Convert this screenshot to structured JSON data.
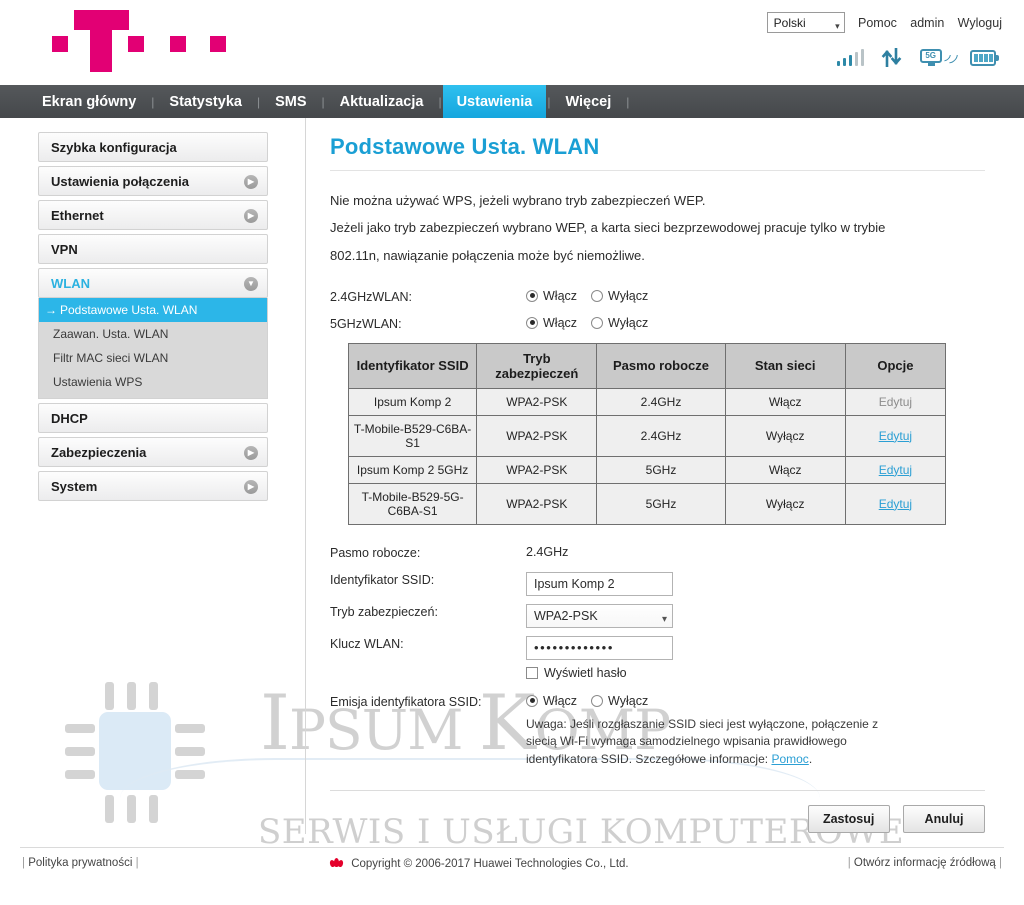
{
  "header": {
    "logo_name": "t-mobile-logo",
    "language": {
      "value": "Polski",
      "caret": "▾"
    },
    "links": [
      {
        "name": "help-link",
        "label": "Pomoc"
      },
      {
        "name": "account-link",
        "label": "admin"
      },
      {
        "name": "logout-link",
        "label": "Wyloguj"
      }
    ],
    "status_icons": [
      {
        "name": "signal-bars-icon",
        "label": "signal-bars"
      },
      {
        "name": "data-transfer-icon",
        "label": "up-down-arrows"
      },
      {
        "name": "network-5g-icon",
        "label": "5G"
      },
      {
        "name": "battery-icon",
        "label": "battery-full"
      }
    ]
  },
  "nav": {
    "separator": "|",
    "items": [
      {
        "label": "Ekran główny",
        "active": false
      },
      {
        "label": "Statystyka",
        "active": false
      },
      {
        "label": "SMS",
        "active": false
      },
      {
        "label": "Aktualizacja",
        "active": false
      },
      {
        "label": "Ustawienia",
        "active": true
      },
      {
        "label": "Więcej",
        "active": false
      }
    ]
  },
  "sidebar": {
    "items": [
      {
        "label": "Szybka konfiguracja",
        "arrow": false
      },
      {
        "label": "Ustawienia połączenia",
        "arrow": true
      },
      {
        "label": "Ethernet",
        "arrow": true
      },
      {
        "label": "VPN",
        "arrow": false
      },
      {
        "label": "WLAN",
        "arrow": true,
        "open": true
      },
      {
        "label": "DHCP",
        "arrow": false
      },
      {
        "label": "Zabezpieczenia",
        "arrow": true
      },
      {
        "label": "System",
        "arrow": true
      }
    ],
    "wlan_subitems": [
      {
        "label": "Podstawowe Usta. WLAN",
        "active": true,
        "arrow": "→"
      },
      {
        "label": "Zaawan. Usta. WLAN",
        "active": false
      },
      {
        "label": "Filtr MAC sieci WLAN",
        "active": false
      },
      {
        "label": "Ustawienia WPS",
        "active": false
      }
    ],
    "arrow_collapsed": "▶",
    "arrow_expanded": "▼"
  },
  "main": {
    "title": "Podstawowe Usta. WLAN",
    "intro": [
      "Nie można używać WPS, jeżeli wybrano tryb zabezpieczeń WEP.",
      "Jeżeli jako tryb zabezpieczeń wybrano WEP, a karta sieci bezprzewodowej pracuje tylko w trybie",
      "802.11n, nawiązanie połączenia może być niemożliwe."
    ],
    "toggle_24": {
      "label": "2.4GHzWLAN:",
      "on_label": "Włącz",
      "off_label": "Wyłącz",
      "selected": "on"
    },
    "toggle_5": {
      "label": "5GHzWLAN:",
      "on_label": "Włącz",
      "off_label": "Wyłącz",
      "selected": "on"
    },
    "table": {
      "columns": [
        "Identyfikator SSID",
        "Tryb zabezpieczeń",
        "Pasmo robocze",
        "Stan sieci",
        "Opcje"
      ],
      "rows": [
        {
          "ssid": "Ipsum Komp 2",
          "mode": "WPA2-PSK",
          "band": "2.4GHz",
          "state": "Włącz",
          "action": "Edytuj",
          "action_enabled": false
        },
        {
          "ssid": "T-Mobile-B529-C6BA-S1",
          "mode": "WPA2-PSK",
          "band": "2.4GHz",
          "state": "Wyłącz",
          "action": "Edytuj",
          "action_enabled": true
        },
        {
          "ssid": "Ipsum Komp 2 5GHz",
          "mode": "WPA2-PSK",
          "band": "5GHz",
          "state": "Włącz",
          "action": "Edytuj",
          "action_enabled": true
        },
        {
          "ssid": "T-Mobile-B529-5G-C6BA-S1",
          "mode": "WPA2-PSK",
          "band": "5GHz",
          "state": "Wyłącz",
          "action": "Edytuj",
          "action_enabled": true
        }
      ]
    },
    "form": {
      "band": {
        "label": "Pasmo robocze:",
        "value": "2.4GHz"
      },
      "ssid": {
        "label": "Identyfikator SSID:",
        "value": "Ipsum Komp 2"
      },
      "security": {
        "label": "Tryb zabezpieczeń:",
        "value": "WPA2-PSK",
        "caret": "▾"
      },
      "key": {
        "label": "Klucz WLAN:",
        "value": "•••••••••••••"
      },
      "show_password": {
        "label": "Wyświetl hasło",
        "checked": false
      },
      "ssid_broadcast": {
        "label": "Emisja identyfikatora SSID:",
        "on_label": "Włącz",
        "off_label": "Wyłącz",
        "selected": "on"
      },
      "note_text": "Uwaga: Jeśli rozgłaszanie SSID sieci jest wyłączone, połączenie z siecią Wi-Fi wymaga samodzielnego wpisania prawidłowego identyfikatora SSID. Szczegółowe informacje: ",
      "note_link": "Pomoc",
      "note_tail": "."
    },
    "buttons": {
      "apply": "Zastosuj",
      "cancel": "Anuluj"
    }
  },
  "footer": {
    "privacy": "Polityka prywatności",
    "copyright": "Copyright © 2006-2017 Huawei Technologies Co., Ltd.",
    "source": "Otwórz informację źródłową",
    "pipe": "|"
  },
  "watermark": {
    "line1_a": "I",
    "line1_b": "PSUM ",
    "line1_c": "K",
    "line1_d": "OMP",
    "line2": "SERWIS I USŁUGI KOMPUTEROWE"
  },
  "colors": {
    "brand_magenta": "#e20074",
    "accent_cyan": "#2cb6e8",
    "title_blue": "#1a9fd4",
    "nav_dark": "#4c4f52",
    "table_header": "#c9c9c9"
  }
}
